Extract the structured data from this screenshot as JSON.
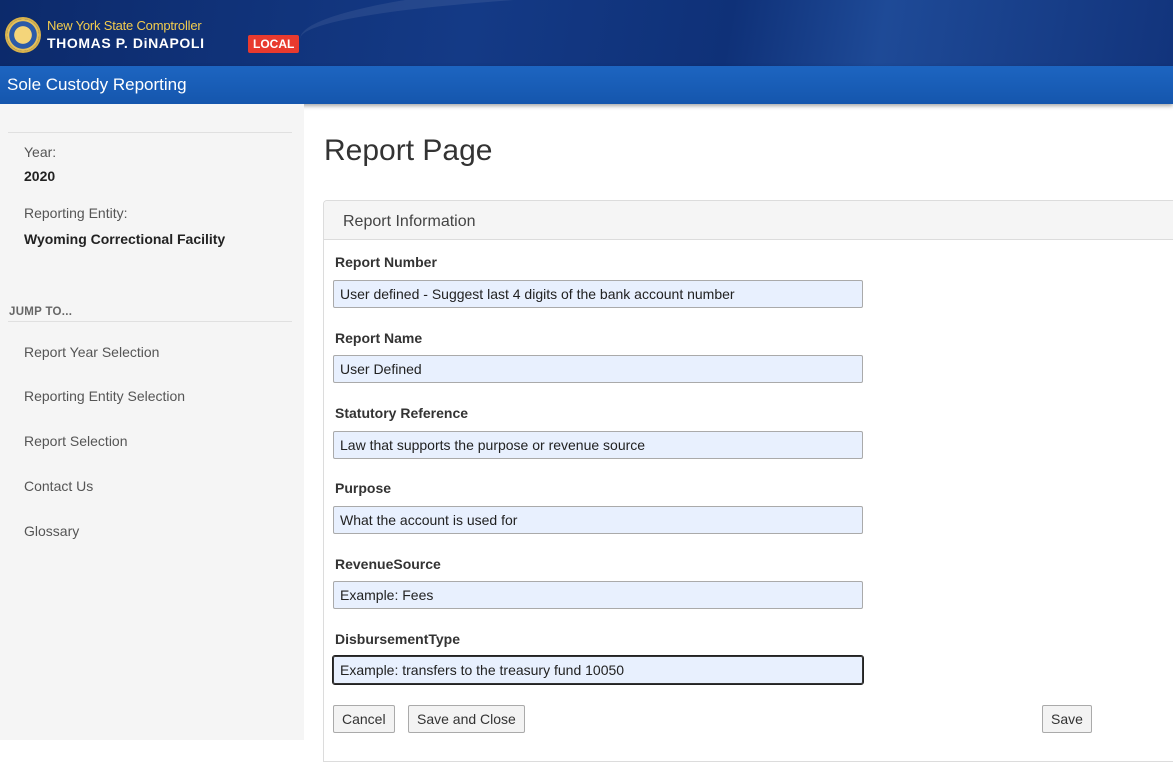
{
  "header": {
    "org_line": "New York State Comptroller",
    "name_line": "THOMAS P. DiNAPOLI",
    "badge": "LOCAL",
    "app_title": "Sole Custody Reporting"
  },
  "sidebar": {
    "year_label": "Year:",
    "year_value": "2020",
    "entity_label": "Reporting Entity:",
    "entity_value": "Wyoming Correctional Facility",
    "jump_heading": "JUMP TO...",
    "links": [
      "Report Year Selection",
      "Reporting Entity Selection",
      "Report Selection",
      "Contact Us",
      "Glossary"
    ]
  },
  "main": {
    "page_title": "Report Page",
    "panel_title": "Report Information",
    "fields": [
      {
        "label": "Report Number",
        "value": "User defined - Suggest last 4 digits of the bank account number"
      },
      {
        "label": "Report Name",
        "value": "User Defined"
      },
      {
        "label": "Statutory Reference",
        "value": "Law that supports the purpose or revenue source"
      },
      {
        "label": "Purpose",
        "value": "What the account is used for"
      },
      {
        "label": "RevenueSource",
        "value": "Example: Fees"
      },
      {
        "label": "DisbursementType",
        "value": "Example: transfers to the treasury fund 10050"
      }
    ],
    "buttons": {
      "cancel": "Cancel",
      "save_close": "Save and Close",
      "save": "Save"
    }
  },
  "colors": {
    "banner": "#0c2a6b",
    "nav_bar": "#1a5eb8",
    "gold_text": "#f2cc4e",
    "local_badge": "#e83a2e",
    "input_fill": "#e8f0fe"
  }
}
